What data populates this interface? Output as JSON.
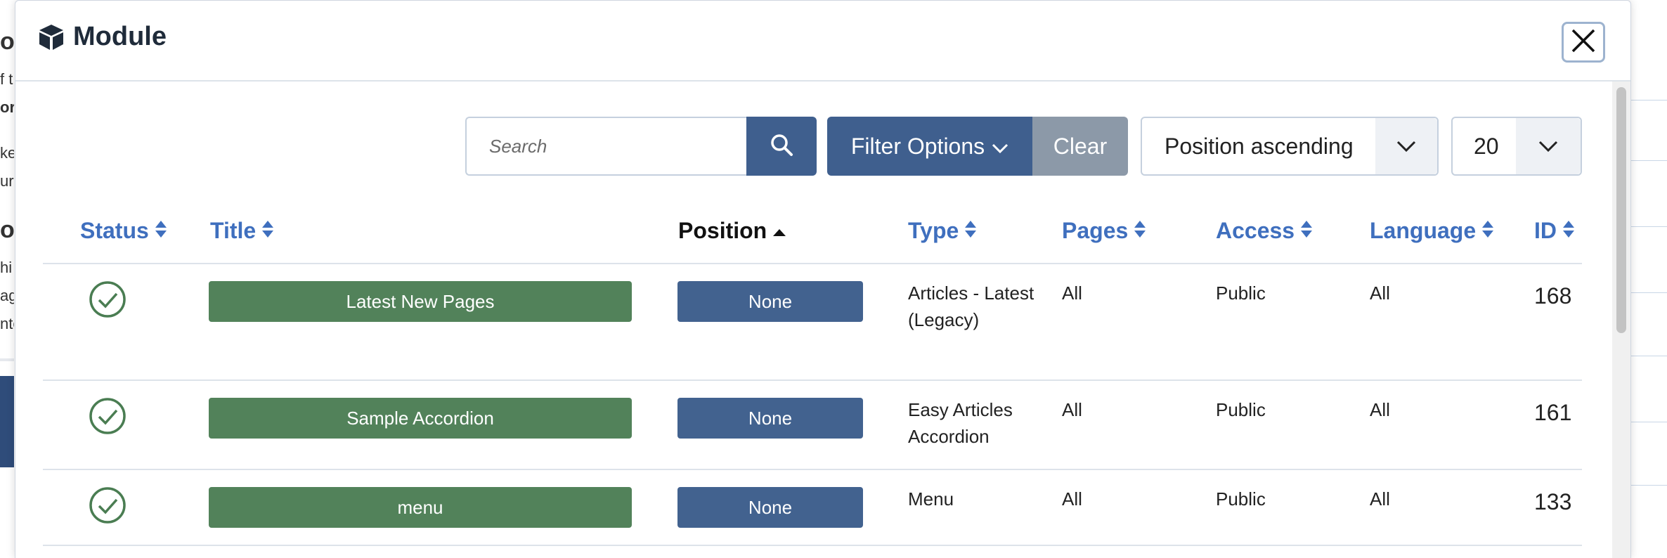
{
  "background": {
    "fragments": [
      "or",
      "f t",
      "or",
      "ke",
      "ur",
      "ou",
      "hi",
      "ag",
      "nte"
    ]
  },
  "modal": {
    "title": "Module",
    "icon": "cube-icon",
    "close_icon": "close-icon"
  },
  "toolbar": {
    "search_placeholder": "Search",
    "search_value": "",
    "filter_label": "Filter Options",
    "clear_label": "Clear",
    "ordering_value": "Position ascending",
    "limit_value": "20"
  },
  "table": {
    "headers": {
      "status": "Status",
      "title": "Title",
      "position": "Position",
      "type": "Type",
      "pages": "Pages",
      "access": "Access",
      "language": "Language",
      "id": "ID"
    },
    "rows": [
      {
        "title": "Latest New Pages",
        "position": "None",
        "type": "Articles - Latest (Legacy)",
        "pages": "All",
        "access": "Public",
        "language": "All",
        "id": "168"
      },
      {
        "title": "Sample Accordion",
        "position": "None",
        "type": "Easy Articles Accordion",
        "pages": "All",
        "access": "Public",
        "language": "All",
        "id": "161"
      },
      {
        "title": "menu",
        "position": "None",
        "type": "Menu",
        "pages": "All",
        "access": "Public",
        "language": "All",
        "id": "133"
      }
    ]
  },
  "colors": {
    "primary": "#3f5f8e",
    "success": "#52825a",
    "link": "#3f6fbe",
    "clear": "#8c99a8"
  }
}
